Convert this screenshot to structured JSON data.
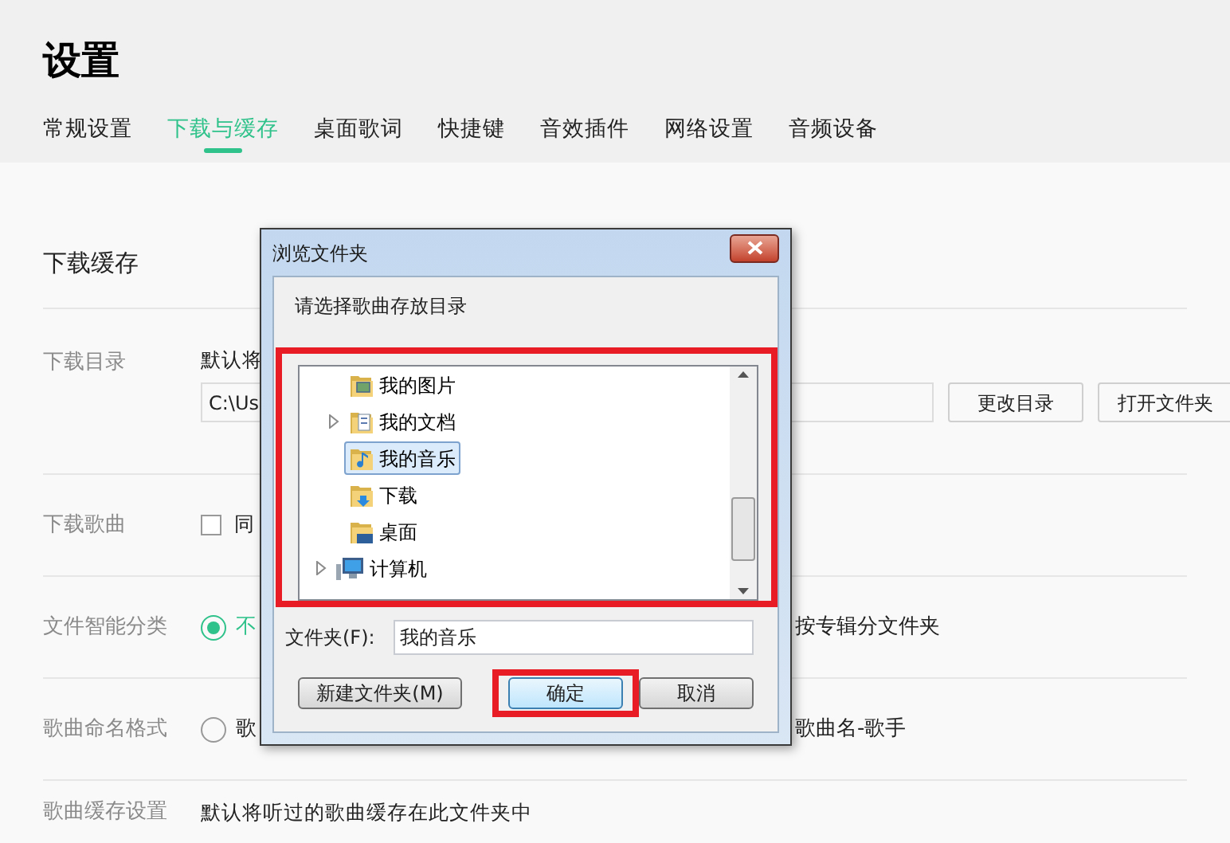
{
  "page_title": "设置",
  "tabs": [
    {
      "label": "常规设置",
      "selected": false
    },
    {
      "label": "下载与缓存",
      "selected": true
    },
    {
      "label": "桌面歌词",
      "selected": false
    },
    {
      "label": "快捷键",
      "selected": false
    },
    {
      "label": "音效插件",
      "selected": false
    },
    {
      "label": "网络设置",
      "selected": false
    },
    {
      "label": "音频设备",
      "selected": false
    }
  ],
  "section_title": "下载缓存",
  "download_dir": {
    "label": "下载目录",
    "note": "默认将",
    "path": "C:\\Us",
    "buttons": [
      "更改目录",
      "打开文件夹"
    ]
  },
  "download_songs": {
    "label": "下载歌曲",
    "checked": false,
    "option": "同"
  },
  "smart_sort": {
    "label": "文件智能分类",
    "options": [
      {
        "label": "不",
        "selected": true
      },
      {
        "label": "按专辑分文件夹",
        "selected": false
      }
    ]
  },
  "naming": {
    "label": "歌曲命名格式",
    "options": [
      {
        "label": "歌",
        "selected": false
      },
      {
        "label": "歌曲名-歌手",
        "selected": false
      }
    ]
  },
  "cache": {
    "label": "歌曲缓存设置",
    "note": "默认将听过的歌曲缓存在此文件夹中"
  },
  "dialog": {
    "title": "浏览文件夹",
    "prompt": "请选择歌曲存放目录",
    "folder_tree": {
      "highlighted": true,
      "items": [
        {
          "children": [
            {
              "label": "我的图片",
              "kind": "pictures",
              "expandable": false,
              "selected": false
            },
            {
              "label": "我的文档",
              "kind": "documents",
              "expandable": true,
              "selected": false
            },
            {
              "label": "我的音乐",
              "kind": "music",
              "expandable": false,
              "selected": true
            },
            {
              "label": "下载",
              "kind": "download",
              "expandable": false,
              "selected": false
            },
            {
              "label": "桌面",
              "kind": "desktop",
              "expandable": false,
              "selected": false
            }
          ]
        },
        {
          "label": "计算机",
          "kind": "computer",
          "expandable": true,
          "selected": false
        }
      ]
    },
    "folder_field": {
      "label": "文件夹(F):",
      "value": "我的音乐"
    },
    "new_folder_button": "新建文件夹(M)",
    "ok_button": {
      "label": "确定",
      "highlighted": true
    },
    "cancel_button": "取消"
  }
}
